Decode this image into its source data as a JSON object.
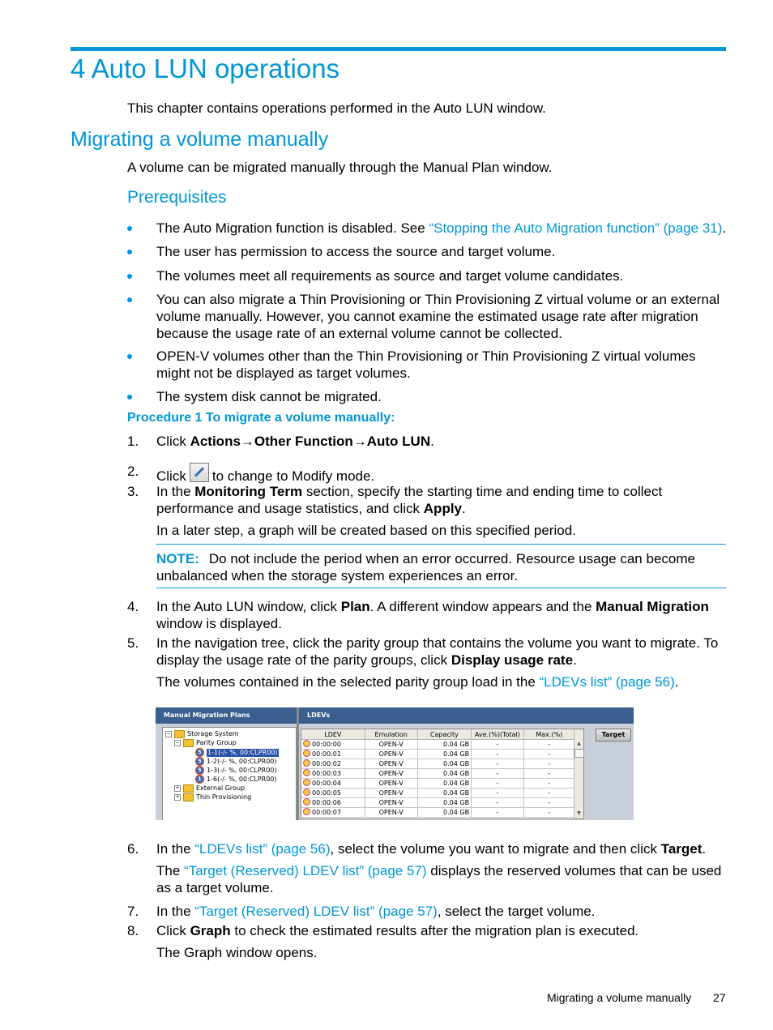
{
  "chapter_title": "4 Auto LUN operations",
  "chapter_intro": "This chapter contains operations performed in the Auto LUN window.",
  "section_title": "Migrating a volume manually",
  "section_intro": "A volume can be migrated manually through the Manual Plan window.",
  "prereq_title": "Prerequisites",
  "prerequisites": [
    {
      "text": "The Auto Migration function is disabled. See ",
      "link": "“Stopping the Auto Migration function” (page 31)",
      "after": "."
    },
    {
      "text": "The user has permission to access the source and target volume."
    },
    {
      "text": "The volumes meet all requirements as source and target volume candidates."
    },
    {
      "text": "You can also migrate a Thin Provisioning or Thin Provisioning Z virtual volume or an external volume manually. However, you cannot examine the estimated usage rate after migration because the usage rate of an external volume cannot be collected."
    },
    {
      "text": "OPEN-V volumes other than the Thin Provisioning or Thin Provisioning Z virtual volumes might not be displayed as target volumes."
    },
    {
      "text": "The system disk cannot be migrated."
    }
  ],
  "procedure_title": "Procedure 1 To migrate a volume manually:",
  "steps": {
    "s1": {
      "num": "1.",
      "a": "Click ",
      "b1": "Actions",
      "arrow1": "→",
      "b2": "Other Function",
      "arrow2": "→",
      "b3": "Auto LUN",
      "end": "."
    },
    "s2": {
      "num": "2.",
      "a": "Click",
      "b": "to change to Modify mode."
    },
    "s3": {
      "num": "3.",
      "a": "In the ",
      "b1": "Monitoring Term",
      "c": " section, specify the starting time and ending time to collect performance and usage statistics, and click ",
      "b2": "Apply",
      "end": ".",
      "sub": "In a later step, a graph will be created based on this specified period."
    },
    "note": {
      "label": "NOTE:",
      "text": "Do not include the period when an error occurred. Resource usage can become unbalanced when the storage system experiences an error."
    },
    "s4": {
      "num": "4.",
      "a": "In the Auto LUN window, click ",
      "b1": "Plan",
      "c": ". A different window appears and the ",
      "b2": "Manual Migration",
      "d": " window is displayed."
    },
    "s5": {
      "num": "5.",
      "a": "In the navigation tree, click the parity group that contains the volume you want to migrate. To display the usage rate of the parity groups, click ",
      "b1": "Display usage rate",
      "end": ".",
      "sub_a": "The volumes contained in the selected parity group load in the ",
      "sub_link": "“LDEVs list” (page 56)",
      "sub_end": "."
    },
    "s6": {
      "num": "6.",
      "a": "In the ",
      "link": "“LDEVs list” (page 56)",
      "c": ", select the volume you want to migrate and then click ",
      "b1": "Target",
      "end": ".",
      "sub_a": "The ",
      "sub_link": "“Target (Reserved) LDEV list” (page 57)",
      "sub_end": " displays the reserved volumes that can be used as a target volume."
    },
    "s7": {
      "num": "7.",
      "a": "In the ",
      "link": "“Target (Reserved) LDEV list” (page 57)",
      "end": ", select the target volume."
    },
    "s8": {
      "num": "8.",
      "a": "Click ",
      "b1": "Graph",
      "c": " to check the estimated results after the migration plan is executed.",
      "sub": "The Graph window opens."
    }
  },
  "screenshot": {
    "left_panel_title": "Manual Migration Plans",
    "right_panel_title": "LDEVs",
    "tree": {
      "root": "Storage System",
      "parity_group": "Parity Group",
      "groups": [
        {
          "badge": "5",
          "label": "1-1(-/- %, 00:CLPR00)",
          "selected": true
        },
        {
          "badge": "5",
          "label": "1-2(-/- %, 00:CLPR00)"
        },
        {
          "badge": "5",
          "label": "1-3(-/- %, 00:CLPR00)"
        },
        {
          "badge": "1",
          "label": "1-6(-/- %, 00:CLPR00)"
        }
      ],
      "external": "External Group",
      "thin": "Thin Provisioning"
    },
    "columns": [
      "LDEV",
      "Emulation",
      "Capacity",
      "Ave.(%)(Total)",
      "Max.(%)"
    ],
    "rows": [
      [
        "00:00:00",
        "OPEN-V",
        "0.04 GB",
        "-",
        "-"
      ],
      [
        "00:00:01",
        "OPEN-V",
        "0.04 GB",
        "-",
        "-"
      ],
      [
        "00:00:02",
        "OPEN-V",
        "0.04 GB",
        "-",
        "-"
      ],
      [
        "00:00:03",
        "OPEN-V",
        "0.04 GB",
        "-",
        "-"
      ],
      [
        "00:00:04",
        "OPEN-V",
        "0.04 GB",
        "-",
        "-"
      ],
      [
        "00:00:05",
        "OPEN-V",
        "0.04 GB",
        "-",
        "-"
      ],
      [
        "00:00:06",
        "OPEN-V",
        "0.04 GB",
        "-",
        "-"
      ],
      [
        "00:00:07",
        "OPEN-V",
        "0.04 GB",
        "-",
        "-"
      ]
    ],
    "target_button": "Target"
  },
  "footer": {
    "section": "Migrating a volume manually",
    "page": "27"
  },
  "colors": {
    "accent": "#0096d6",
    "panel_header": "#3a5f8e"
  }
}
